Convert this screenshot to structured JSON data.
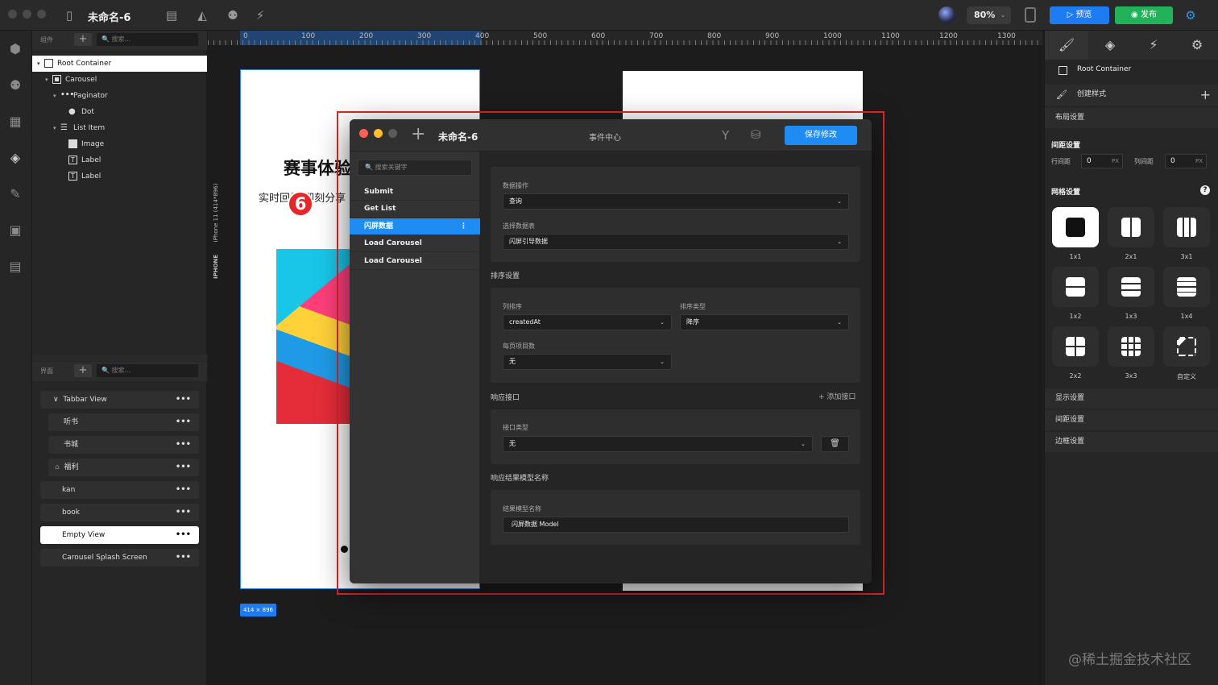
{
  "app": {
    "title": "未命名-6",
    "zoom": "80%",
    "preview": "预览",
    "publish": "发布"
  },
  "components_panel": {
    "label": "组件",
    "search_placeholder": "搜索...",
    "tree": [
      {
        "label": "Root Container",
        "depth": 0,
        "icon": "square-icon"
      },
      {
        "label": "Carousel",
        "depth": 1,
        "icon": "carousel-icon"
      },
      {
        "label": "Paginator",
        "depth": 2,
        "icon": "dots-icon"
      },
      {
        "label": "Dot",
        "depth": 3,
        "icon": "dot-icon"
      },
      {
        "label": "List Item",
        "depth": 2,
        "icon": "list-icon"
      },
      {
        "label": "Image",
        "depth": 3,
        "icon": "image-icon"
      },
      {
        "label": "Label",
        "depth": 3,
        "icon": "text-icon"
      },
      {
        "label": "Label",
        "depth": 3,
        "icon": "text-icon"
      }
    ]
  },
  "pages_panel": {
    "label": "界面",
    "search_placeholder": "搜索...",
    "pages": [
      "Tabbar View",
      "听书",
      "书城",
      "福利",
      "kan",
      "book",
      "Empty View",
      "Carousel Splash Screen"
    ]
  },
  "canvas": {
    "ruler": [
      "0",
      "100",
      "200",
      "300",
      "400",
      "500",
      "600",
      "700",
      "800",
      "900",
      "1000",
      "1100",
      "1200",
      "1300"
    ],
    "device_label": "iPhone 11 (414*896)",
    "device_type": "IPHONE",
    "size_badge": "414 × 896",
    "headline": "赛事体验",
    "subline": "实时回看,即刻分享",
    "step_badge": "6"
  },
  "event_center": {
    "doc_title": "未命名-6",
    "title": "事件中心",
    "save": "保存修改",
    "search_placeholder": "搜索关键字",
    "events": [
      "Submit",
      "Get List",
      "闪屏数据",
      "Load Carousel",
      "Load Carousel"
    ],
    "data_op": {
      "label": "数据操作",
      "value": "查询"
    },
    "table": {
      "label": "选择数据表",
      "value": "闪屏引导数据"
    },
    "sort": {
      "title": "排序设置",
      "column_label": "列排序",
      "column_value": "createdAt",
      "type_label": "排序类型",
      "type_value": "降序",
      "per_page_label": "每页项目数",
      "per_page_value": "无"
    },
    "response": {
      "title": "响应接口",
      "add": "添加接口",
      "type_label": "接口类型",
      "type_value": "无"
    },
    "model": {
      "title": "响应结果模型名称",
      "label": "结果模型名称",
      "value": "闪屏数据 Model"
    }
  },
  "inspector": {
    "root": "Root Container",
    "create_style": "创建样式",
    "layout": "布局设置",
    "spacing_title": "间距设置",
    "row_gap_label": "行间距",
    "row_gap": "0",
    "unit": "PX",
    "col_gap_label": "列间距",
    "col_gap": "0",
    "grid_title": "网格设置",
    "grids": [
      "1x1",
      "2x1",
      "3x1",
      "1x2",
      "1x3",
      "1x4",
      "2x2",
      "3x3",
      "自定义"
    ],
    "sections": [
      "显示设置",
      "间距设置",
      "边框设置"
    ]
  },
  "watermark": "@稀土掘金技术社区"
}
